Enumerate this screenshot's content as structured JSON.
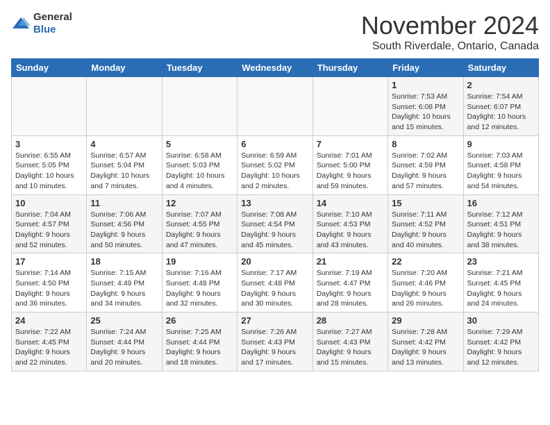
{
  "header": {
    "logo_general": "General",
    "logo_blue": "Blue",
    "month": "November 2024",
    "location": "South Riverdale, Ontario, Canada"
  },
  "weekdays": [
    "Sunday",
    "Monday",
    "Tuesday",
    "Wednesday",
    "Thursday",
    "Friday",
    "Saturday"
  ],
  "weeks": [
    [
      {
        "day": "",
        "info": ""
      },
      {
        "day": "",
        "info": ""
      },
      {
        "day": "",
        "info": ""
      },
      {
        "day": "",
        "info": ""
      },
      {
        "day": "",
        "info": ""
      },
      {
        "day": "1",
        "info": "Sunrise: 7:53 AM\nSunset: 6:08 PM\nDaylight: 10 hours and 15 minutes."
      },
      {
        "day": "2",
        "info": "Sunrise: 7:54 AM\nSunset: 6:07 PM\nDaylight: 10 hours and 12 minutes."
      }
    ],
    [
      {
        "day": "3",
        "info": "Sunrise: 6:55 AM\nSunset: 5:05 PM\nDaylight: 10 hours and 10 minutes."
      },
      {
        "day": "4",
        "info": "Sunrise: 6:57 AM\nSunset: 5:04 PM\nDaylight: 10 hours and 7 minutes."
      },
      {
        "day": "5",
        "info": "Sunrise: 6:58 AM\nSunset: 5:03 PM\nDaylight: 10 hours and 4 minutes."
      },
      {
        "day": "6",
        "info": "Sunrise: 6:59 AM\nSunset: 5:02 PM\nDaylight: 10 hours and 2 minutes."
      },
      {
        "day": "7",
        "info": "Sunrise: 7:01 AM\nSunset: 5:00 PM\nDaylight: 9 hours and 59 minutes."
      },
      {
        "day": "8",
        "info": "Sunrise: 7:02 AM\nSunset: 4:59 PM\nDaylight: 9 hours and 57 minutes."
      },
      {
        "day": "9",
        "info": "Sunrise: 7:03 AM\nSunset: 4:58 PM\nDaylight: 9 hours and 54 minutes."
      }
    ],
    [
      {
        "day": "10",
        "info": "Sunrise: 7:04 AM\nSunset: 4:57 PM\nDaylight: 9 hours and 52 minutes."
      },
      {
        "day": "11",
        "info": "Sunrise: 7:06 AM\nSunset: 4:56 PM\nDaylight: 9 hours and 50 minutes."
      },
      {
        "day": "12",
        "info": "Sunrise: 7:07 AM\nSunset: 4:55 PM\nDaylight: 9 hours and 47 minutes."
      },
      {
        "day": "13",
        "info": "Sunrise: 7:08 AM\nSunset: 4:54 PM\nDaylight: 9 hours and 45 minutes."
      },
      {
        "day": "14",
        "info": "Sunrise: 7:10 AM\nSunset: 4:53 PM\nDaylight: 9 hours and 43 minutes."
      },
      {
        "day": "15",
        "info": "Sunrise: 7:11 AM\nSunset: 4:52 PM\nDaylight: 9 hours and 40 minutes."
      },
      {
        "day": "16",
        "info": "Sunrise: 7:12 AM\nSunset: 4:51 PM\nDaylight: 9 hours and 38 minutes."
      }
    ],
    [
      {
        "day": "17",
        "info": "Sunrise: 7:14 AM\nSunset: 4:50 PM\nDaylight: 9 hours and 36 minutes."
      },
      {
        "day": "18",
        "info": "Sunrise: 7:15 AM\nSunset: 4:49 PM\nDaylight: 9 hours and 34 minutes."
      },
      {
        "day": "19",
        "info": "Sunrise: 7:16 AM\nSunset: 4:48 PM\nDaylight: 9 hours and 32 minutes."
      },
      {
        "day": "20",
        "info": "Sunrise: 7:17 AM\nSunset: 4:48 PM\nDaylight: 9 hours and 30 minutes."
      },
      {
        "day": "21",
        "info": "Sunrise: 7:19 AM\nSunset: 4:47 PM\nDaylight: 9 hours and 28 minutes."
      },
      {
        "day": "22",
        "info": "Sunrise: 7:20 AM\nSunset: 4:46 PM\nDaylight: 9 hours and 26 minutes."
      },
      {
        "day": "23",
        "info": "Sunrise: 7:21 AM\nSunset: 4:45 PM\nDaylight: 9 hours and 24 minutes."
      }
    ],
    [
      {
        "day": "24",
        "info": "Sunrise: 7:22 AM\nSunset: 4:45 PM\nDaylight: 9 hours and 22 minutes."
      },
      {
        "day": "25",
        "info": "Sunrise: 7:24 AM\nSunset: 4:44 PM\nDaylight: 9 hours and 20 minutes."
      },
      {
        "day": "26",
        "info": "Sunrise: 7:25 AM\nSunset: 4:44 PM\nDaylight: 9 hours and 18 minutes."
      },
      {
        "day": "27",
        "info": "Sunrise: 7:26 AM\nSunset: 4:43 PM\nDaylight: 9 hours and 17 minutes."
      },
      {
        "day": "28",
        "info": "Sunrise: 7:27 AM\nSunset: 4:43 PM\nDaylight: 9 hours and 15 minutes."
      },
      {
        "day": "29",
        "info": "Sunrise: 7:28 AM\nSunset: 4:42 PM\nDaylight: 9 hours and 13 minutes."
      },
      {
        "day": "30",
        "info": "Sunrise: 7:29 AM\nSunset: 4:42 PM\nDaylight: 9 hours and 12 minutes."
      }
    ]
  ]
}
